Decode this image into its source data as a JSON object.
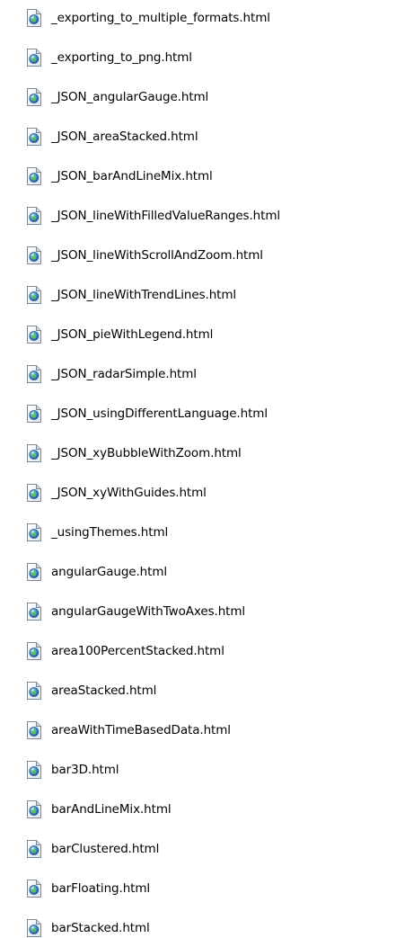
{
  "file_list": {
    "icon": "html-file-icon",
    "items": [
      {
        "name": "_exporting_to_multiple_formats.html"
      },
      {
        "name": "_exporting_to_png.html"
      },
      {
        "name": "_JSON_angularGauge.html"
      },
      {
        "name": "_JSON_areaStacked.html"
      },
      {
        "name": "_JSON_barAndLineMix.html"
      },
      {
        "name": "_JSON_lineWithFilledValueRanges.html"
      },
      {
        "name": "_JSON_lineWithScrollAndZoom.html"
      },
      {
        "name": "_JSON_lineWithTrendLines.html"
      },
      {
        "name": "_JSON_pieWithLegend.html"
      },
      {
        "name": "_JSON_radarSimple.html"
      },
      {
        "name": "_JSON_usingDifferentLanguage.html"
      },
      {
        "name": "_JSON_xyBubbleWithZoom.html"
      },
      {
        "name": "_JSON_xyWithGuides.html"
      },
      {
        "name": "_usingThemes.html"
      },
      {
        "name": "angularGauge.html"
      },
      {
        "name": "angularGaugeWithTwoAxes.html"
      },
      {
        "name": "area100PercentStacked.html"
      },
      {
        "name": "areaStacked.html"
      },
      {
        "name": "areaWithTimeBasedData.html"
      },
      {
        "name": "bar3D.html"
      },
      {
        "name": "barAndLineMix.html"
      },
      {
        "name": "barClustered.html"
      },
      {
        "name": "barFloating.html"
      },
      {
        "name": "barStacked.html"
      }
    ]
  }
}
